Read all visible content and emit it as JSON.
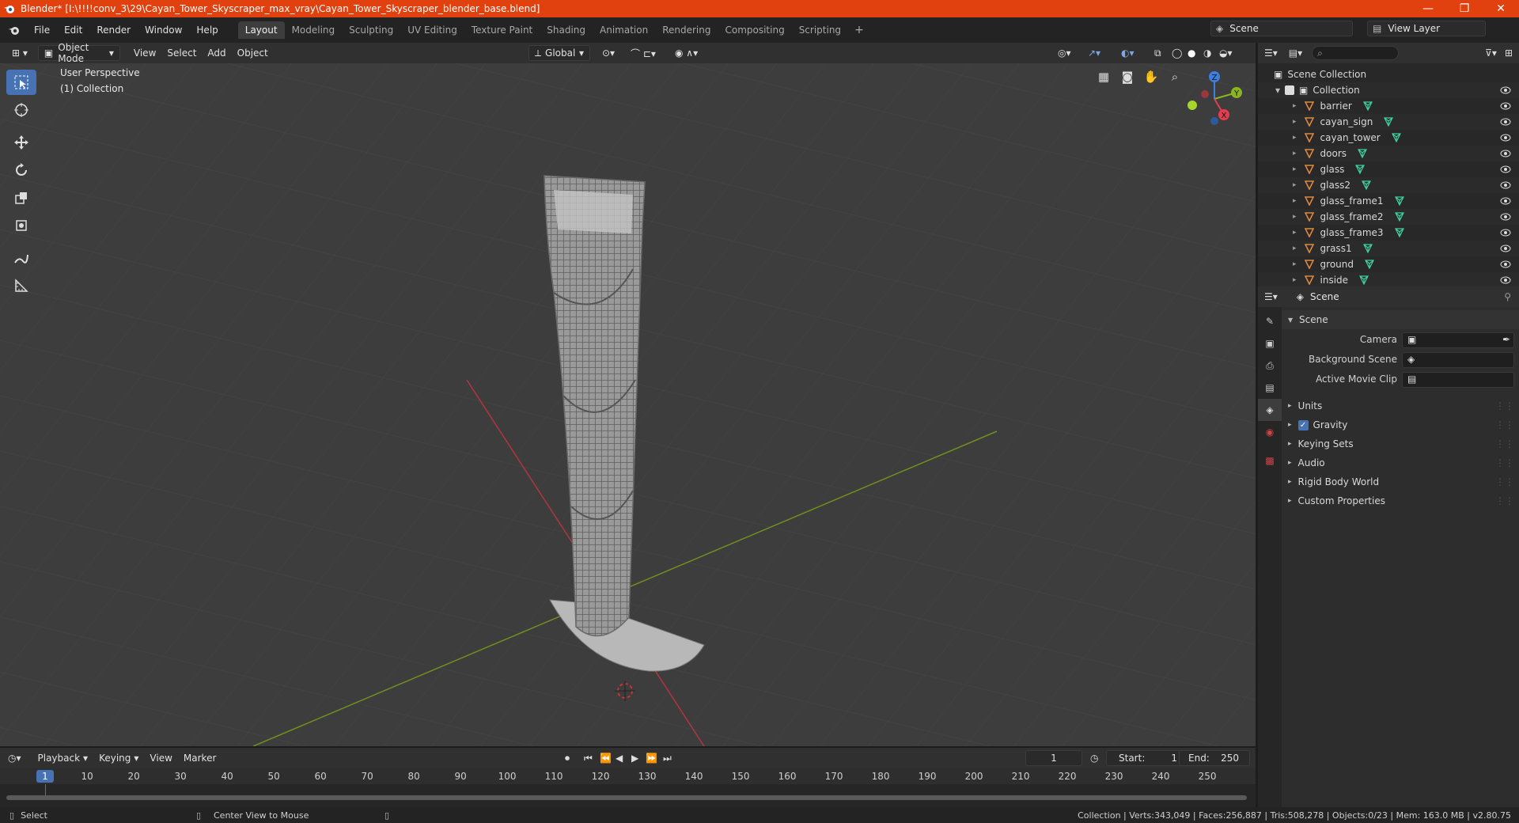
{
  "window": {
    "title": "Blender* [I:\\!!!!conv_3\\29\\Cayan_Tower_Skyscraper_max_vray\\Cayan_Tower_Skyscraper_blender_base.blend]",
    "minimize": "—",
    "maximize": "❐",
    "close": "✕"
  },
  "menu": [
    "File",
    "Edit",
    "Render",
    "Window",
    "Help"
  ],
  "workspaces": [
    "Layout",
    "Modeling",
    "Sculpting",
    "UV Editing",
    "Texture Paint",
    "Shading",
    "Animation",
    "Rendering",
    "Compositing",
    "Scripting"
  ],
  "active_workspace": "Layout",
  "scene_name": "Scene",
  "view_layer": "View Layer",
  "viewport_header": {
    "mode": "Object Mode",
    "menus": [
      "View",
      "Select",
      "Add",
      "Object"
    ],
    "transform_orientation": "Global"
  },
  "viewport": {
    "perspective_label": "User Perspective",
    "collection_label": "(1) Collection",
    "gizmo_axes": {
      "x": "X",
      "y": "Y",
      "z": "Z"
    }
  },
  "outliner": {
    "root": "Scene Collection",
    "collection": "Collection",
    "objects": [
      "barrier",
      "cayan_sign",
      "cayan_tower",
      "doors",
      "glass",
      "glass2",
      "glass_frame1",
      "glass_frame2",
      "glass_frame3",
      "grass1",
      "ground",
      "inside"
    ]
  },
  "properties": {
    "header_title": "Scene",
    "panel_title": "Scene",
    "fields": {
      "camera": "Camera",
      "background_scene": "Background Scene",
      "active_movie_clip": "Active Movie Clip"
    },
    "sections": [
      "Units",
      "Gravity",
      "Keying Sets",
      "Audio",
      "Rigid Body World",
      "Custom Properties"
    ],
    "gravity_checked": true
  },
  "timeline": {
    "menus": [
      "Playback",
      "Keying",
      "View",
      "Marker"
    ],
    "current_frame": "1",
    "start_label": "Start:",
    "start": "1",
    "end_label": "End:",
    "end": "250",
    "ticks": [
      "1",
      "10",
      "20",
      "30",
      "40",
      "50",
      "60",
      "70",
      "80",
      "90",
      "100",
      "110",
      "120",
      "130",
      "140",
      "150",
      "160",
      "170",
      "180",
      "190",
      "200",
      "210",
      "220",
      "230",
      "240",
      "250"
    ]
  },
  "statusbar": {
    "left_action": "Select",
    "middle_action": "Center View to Mouse",
    "stats": "Collection | Verts:343,049 | Faces:256,887 | Tris:508,278 | Objects:0/23 | Mem: 163.0 MB | v2.80.75"
  },
  "colors": {
    "accent": "#4772b3",
    "titlebar": "#e1400f",
    "axis_x": "#e33e4f",
    "axis_y": "#8ab51f",
    "axis_z": "#3b80e0",
    "mesh_icon": "#3fd0a0",
    "object_icon": "#e0883a"
  }
}
